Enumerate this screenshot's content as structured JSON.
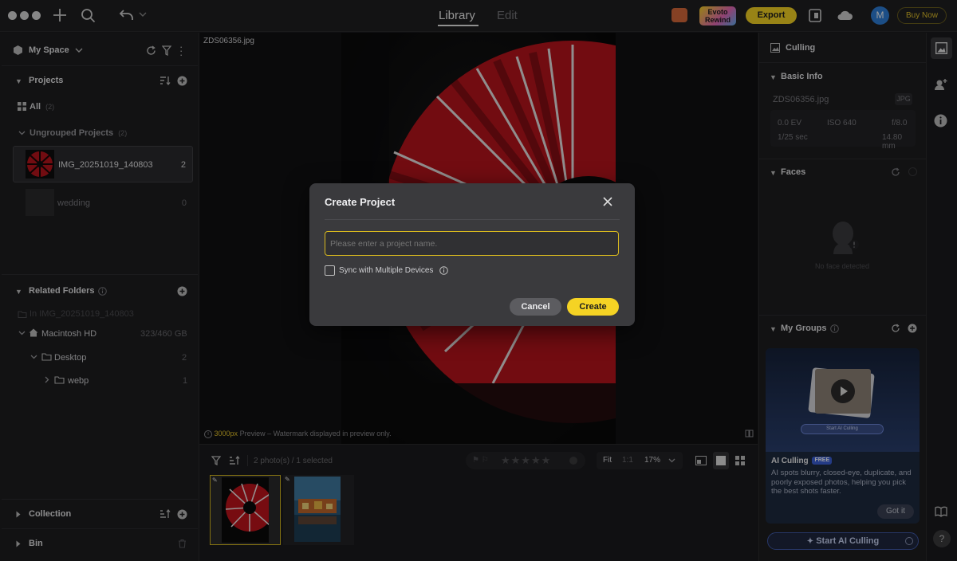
{
  "topbar": {
    "tab_library": "Library",
    "tab_edit": "Edit",
    "badge_evoto": "Evoto",
    "badge_rewind": "Rewind",
    "export_label": "Export",
    "avatar_letter": "M",
    "buy_now_label": "Buy Now"
  },
  "left": {
    "space_title": "My Space",
    "projects_title": "Projects",
    "all_label": "All",
    "all_count": "(2)",
    "ungrouped_label": "Ungrouped Projects",
    "ungrouped_count": "(2)",
    "projects": [
      {
        "name": "IMG_20251019_140803",
        "count": "2"
      },
      {
        "name": "wedding",
        "count": "0"
      }
    ],
    "related_title": "Related Folders",
    "related_in": "In IMG_20251019_140803",
    "disk_name": "Macintosh HD",
    "disk_size": "323/460 GB",
    "folders": [
      {
        "name": "Desktop",
        "count": "2"
      },
      {
        "name": "webp",
        "count": "1"
      }
    ],
    "collection_title": "Collection",
    "bin_title": "Bin"
  },
  "center": {
    "filename": "ZDS06356.jpg",
    "preview_px": "3000px",
    "preview_note": "Preview – Watermark displayed in preview only."
  },
  "filmstrip": {
    "count_text": "2 photo(s) / 1 selected",
    "fit_label": "Fit",
    "ratio_label": "1:1",
    "zoom_value": "17%",
    "rating": 0
  },
  "right": {
    "culling_title": "Culling",
    "basic_info_title": "Basic Info",
    "filename": "ZDS06356.jpg",
    "format": "JPG",
    "ev": "0.0 EV",
    "iso": "ISO 640",
    "aperture": "f/8.0",
    "shutter": "1/25 sec",
    "focal": "14.80 mm",
    "faces_title": "Faces",
    "no_face": "No face detected",
    "groups_title": "My Groups",
    "promo_button": "Start AI Culling",
    "promo_title": "AI Culling",
    "promo_badge": "FREE",
    "promo_desc": "AI spots blurry, closed-eye, duplicate, and poorly exposed photos, helping you pick the best shots faster.",
    "got_it": "Got it",
    "start_button": "Start AI Culling"
  },
  "modal": {
    "title": "Create Project",
    "input_placeholder": "Please enter a project name.",
    "input_value": "",
    "sync_label": "Sync with Multiple Devices",
    "cancel_label": "Cancel",
    "create_label": "Create"
  },
  "colors": {
    "accent_yellow": "#f5d324",
    "background": "#1b1b1d",
    "modal": "#3a3a3d"
  }
}
